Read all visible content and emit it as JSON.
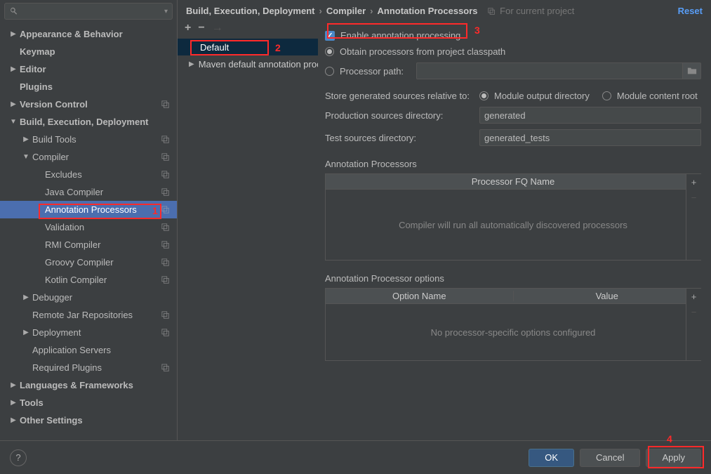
{
  "search": {
    "placeholder": ""
  },
  "tree": [
    {
      "label": "Appearance & Behavior",
      "depth": 1,
      "arrow": "right",
      "bold": true
    },
    {
      "label": "Keymap",
      "depth": 1,
      "arrow": "none",
      "bold": true
    },
    {
      "label": "Editor",
      "depth": 1,
      "arrow": "right",
      "bold": true
    },
    {
      "label": "Plugins",
      "depth": 1,
      "arrow": "none",
      "bold": true
    },
    {
      "label": "Version Control",
      "depth": 1,
      "arrow": "right",
      "bold": true,
      "copy": true
    },
    {
      "label": "Build, Execution, Deployment",
      "depth": 1,
      "arrow": "down",
      "bold": true
    },
    {
      "label": "Build Tools",
      "depth": 2,
      "arrow": "right",
      "copy": true
    },
    {
      "label": "Compiler",
      "depth": 2,
      "arrow": "down",
      "copy": true
    },
    {
      "label": "Excludes",
      "depth": 3,
      "arrow": "none",
      "copy": true
    },
    {
      "label": "Java Compiler",
      "depth": 3,
      "arrow": "none",
      "copy": true
    },
    {
      "label": "Annotation Processors",
      "depth": 3,
      "arrow": "none",
      "copy": true,
      "selected": true
    },
    {
      "label": "Validation",
      "depth": 3,
      "arrow": "none",
      "copy": true
    },
    {
      "label": "RMI Compiler",
      "depth": 3,
      "arrow": "none",
      "copy": true
    },
    {
      "label": "Groovy Compiler",
      "depth": 3,
      "arrow": "none",
      "copy": true
    },
    {
      "label": "Kotlin Compiler",
      "depth": 3,
      "arrow": "none",
      "copy": true
    },
    {
      "label": "Debugger",
      "depth": 2,
      "arrow": "right"
    },
    {
      "label": "Remote Jar Repositories",
      "depth": 2,
      "arrow": "none",
      "copy": true
    },
    {
      "label": "Deployment",
      "depth": 2,
      "arrow": "right",
      "copy": true
    },
    {
      "label": "Application Servers",
      "depth": 2,
      "arrow": "none"
    },
    {
      "label": "Required Plugins",
      "depth": 2,
      "arrow": "none",
      "copy": true
    },
    {
      "label": "Languages & Frameworks",
      "depth": 1,
      "arrow": "right",
      "bold": true
    },
    {
      "label": "Tools",
      "depth": 1,
      "arrow": "right",
      "bold": true
    },
    {
      "label": "Other Settings",
      "depth": 1,
      "arrow": "right",
      "bold": true
    }
  ],
  "breadcrumb": {
    "a": "Build, Execution, Deployment",
    "b": "Compiler",
    "c": "Annotation Processors",
    "scope": "For current project"
  },
  "reset": "Reset",
  "profiles": [
    {
      "label": "Default",
      "arrow": "none",
      "selected": true
    },
    {
      "label": "Maven default annotation processors",
      "arrow": "right"
    }
  ],
  "form": {
    "enable": "Enable annotation processing",
    "obtain": "Obtain processors from project classpath",
    "pp": "Processor path:",
    "store": "Store generated sources relative to:",
    "mod_out": "Module output directory",
    "mod_content": "Module content root",
    "prod": "Production sources directory:",
    "prod_val": "generated",
    "test": "Test sources directory:",
    "test_val": "generated_tests"
  },
  "ap_section": "Annotation Processors",
  "ap_header": "Processor FQ Name",
  "ap_empty": "Compiler will run all automatically discovered processors",
  "opt_section": "Annotation Processor options",
  "opt_h1": "Option Name",
  "opt_h2": "Value",
  "opt_empty": "No processor-specific options configured",
  "buttons": {
    "ok": "OK",
    "cancel": "Cancel",
    "apply": "Apply"
  },
  "annotations": {
    "n1": "1",
    "n2": "2",
    "n3": "3",
    "n4": "4"
  }
}
